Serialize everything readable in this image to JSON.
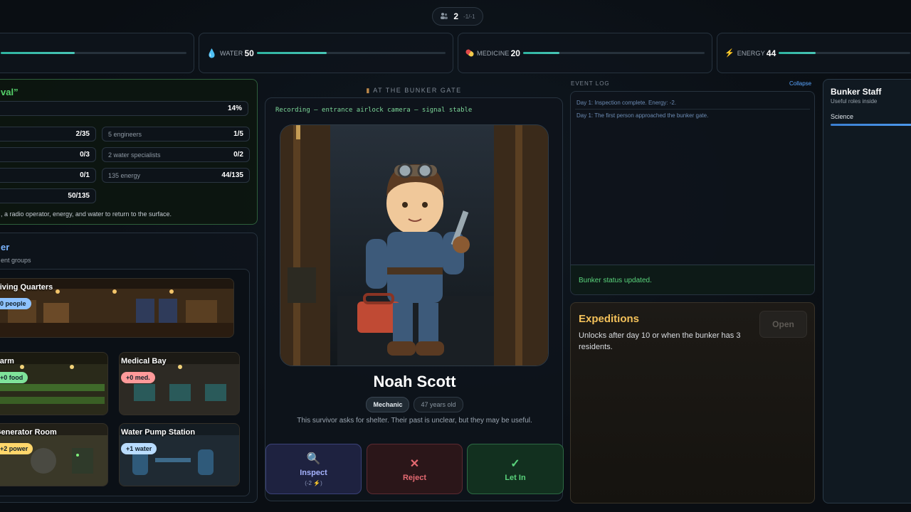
{
  "top": {
    "count": "2",
    "sub": "-1/-1"
  },
  "resources": [
    {
      "key": "food",
      "label": "",
      "value": "",
      "icon": "food-icon",
      "fill": 0.4
    },
    {
      "key": "water",
      "label": "WATER",
      "value": "50",
      "icon": "water-drop-icon",
      "fill": 0.37
    },
    {
      "key": "medicine",
      "label": "MEDICINE",
      "value": "20",
      "icon": "pill-icon",
      "fill": 0.2
    },
    {
      "key": "energy",
      "label": "ENERGY",
      "value": "44",
      "icon": "lightning-icon",
      "fill": 0.28
    }
  ],
  "survival": {
    "title": "val”",
    "progress": "14%",
    "rows_left": [
      "2/35",
      "0/3",
      "0/1",
      "50/135"
    ],
    "rows_right": [
      {
        "label": "5 engineers",
        "value": "1/5"
      },
      {
        "label": "2 water specialists",
        "value": "0/2"
      },
      {
        "label": "135 energy",
        "value": "44/135"
      }
    ],
    "footer": ", a radio operator, energy, and water to return to the surface."
  },
  "rooms": {
    "title": "er",
    "subtitle": "ent groups",
    "items": [
      {
        "name": "Living Quarters",
        "badge": "0 people",
        "badge_color": "#8ec2ff"
      },
      {
        "name": "Farm",
        "badge": "+0 food",
        "badge_color": "#7fe39a"
      },
      {
        "name": "Medical Bay",
        "badge": "+0 med.",
        "badge_color": "#ff9a9a"
      },
      {
        "name": "Generator Room",
        "badge": "+2 power",
        "badge_color": "#ffd66b"
      },
      {
        "name": "Water Pump Station",
        "badge": "+1 water",
        "badge_color": "#b9dcff"
      }
    ]
  },
  "gate": {
    "title": "AT THE BUNKER GATE",
    "recording": "Recording — entrance airlock camera — signal stable",
    "name": "Noah Scott",
    "role": "Mechanic",
    "age": "47 years old",
    "description": "This survivor asks for shelter. Their past is unclear, but they may be useful.",
    "actions": {
      "inspect": {
        "label": "Inspect",
        "cost": "(-2 ⚡)"
      },
      "reject": {
        "label": "Reject"
      },
      "letin": {
        "label": "Let In"
      }
    }
  },
  "event_log": {
    "label": "EVENT LOG",
    "collapse": "Collapse",
    "entries": [
      "Day 1: Inspection complete. Energy: -2.",
      "Day 1: The first person approached the bunker gate."
    ],
    "status": "Bunker status updated."
  },
  "expeditions": {
    "title": "Expeditions",
    "description": "Unlocks after day 10 or when the bunker has 3 residents.",
    "button": "Open"
  },
  "staff": {
    "title": "Bunker Staff",
    "subtitle": "Useful roles inside",
    "items": [
      "Science"
    ]
  }
}
